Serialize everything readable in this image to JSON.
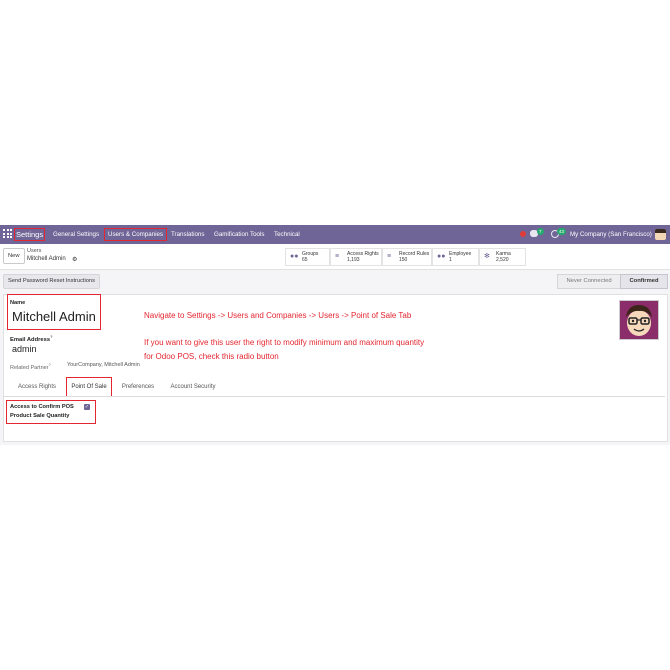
{
  "nav": {
    "brand": "Settings",
    "items": [
      "General Settings",
      "Users & Companies",
      "Translations",
      "Gamification Tools",
      "Technical"
    ],
    "chat_badge": "7",
    "activity_badge": "43",
    "company": "My Company (San Francisco)"
  },
  "control_panel": {
    "new_label": "New",
    "breadcrumb_parent": "Users",
    "breadcrumb_current": "Mitchell Admin",
    "gear_glyph": "⚙",
    "stats": [
      {
        "label": "Groups",
        "value": "65",
        "icon": "users-icon"
      },
      {
        "label": "Access Rights",
        "value": "1,193",
        "icon": "list-icon"
      },
      {
        "label": "Record Rules",
        "value": "150",
        "icon": "list-icon"
      },
      {
        "label": "Employee",
        "value": "1",
        "icon": "users-icon"
      },
      {
        "label": "Karma",
        "value": "2,520",
        "icon": "star-icon"
      }
    ]
  },
  "status": {
    "reset_button": "Send Password Reset Instructions",
    "stages": [
      "Never Connected",
      "Confirmed"
    ]
  },
  "form": {
    "name_label": "Name",
    "name_value": "Mitchell Admin",
    "email_label": "Email Address",
    "email_superscript": "?",
    "email_value": "admin",
    "related_partner_label": "Related Partner",
    "related_partner_superscript": "?",
    "related_partner_value": "YourCompany, Mitchell Admin",
    "tabs": [
      "Access Rights",
      "Point Of Sale",
      "Preferences",
      "Account Security"
    ],
    "pos_field_line1": "Access to Confirm POS",
    "pos_field_line2": "Product Sale Quantity"
  },
  "annotations": {
    "line1": "Navigate to Settings -> Users and Companies -> Users -> Point of Sale Tab",
    "line2": "If you want to give this user the right to modify minimum and maximum quantity",
    "line3": "for Odoo POS, check this radio button"
  },
  "colors": {
    "navbar": "#6f6596",
    "highlight": "#e3262f",
    "checkbox": "#6f6596"
  }
}
